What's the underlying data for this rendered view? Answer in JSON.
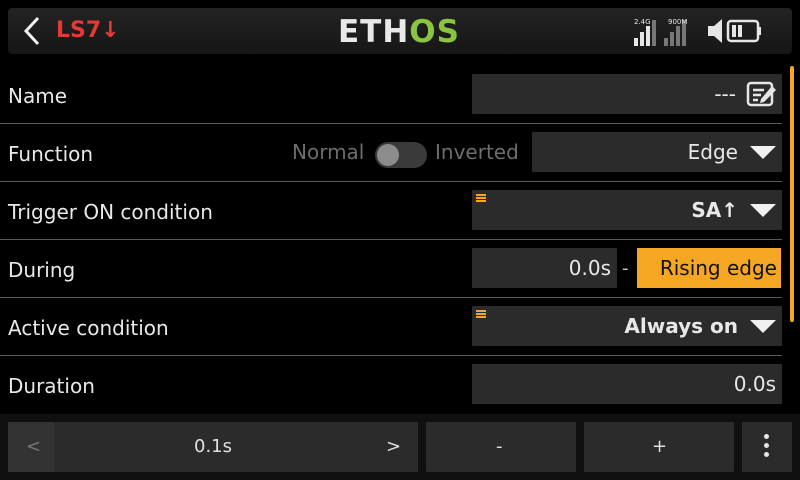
{
  "header": {
    "back_icon": "chevron-left-icon",
    "title": "LS7",
    "title_arrow": "↓",
    "logo_white": "ETH",
    "logo_green": "OS",
    "status": {
      "rf1_label": "2.4G",
      "rf2_label": "900M",
      "icons": [
        "signal-2-4g-icon",
        "signal-900m-icon",
        "speaker-icon",
        "battery-icon"
      ]
    }
  },
  "rows": {
    "name": {
      "label": "Name",
      "value": "---",
      "icon": "edit-icon"
    },
    "function": {
      "label": "Function",
      "toggle_left": "Normal",
      "toggle_right": "Inverted",
      "value": "Edge"
    },
    "trigger": {
      "label": "Trigger ON condition",
      "value": "SA↑"
    },
    "during": {
      "label": "During",
      "value": "0.0s",
      "separator": "-",
      "value2": "Rising edge"
    },
    "active": {
      "label": "Active condition",
      "value": "Always on"
    },
    "duration": {
      "label": "Duration",
      "value": "0.0s"
    }
  },
  "footer": {
    "prev_label": "<",
    "step_value": "0.1s",
    "next_label": ">",
    "minus_label": "-",
    "plus_label": "+",
    "menu_icon": "more-vertical-icon"
  },
  "colors": {
    "accent": "#f5a623",
    "title_red": "#e53935",
    "logo_green": "#8bc53f"
  }
}
